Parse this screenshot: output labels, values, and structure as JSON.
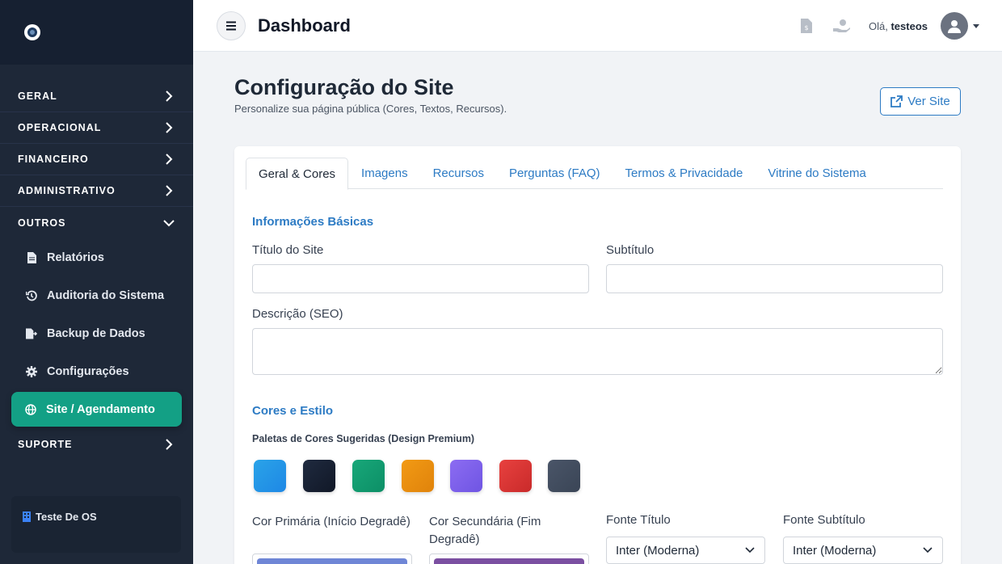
{
  "sidebar": {
    "sections": [
      {
        "label": "GERAL"
      },
      {
        "label": "OPERACIONAL"
      },
      {
        "label": "FINANCEIRO"
      },
      {
        "label": "ADMINISTRATIVO"
      },
      {
        "label": "OUTROS"
      }
    ],
    "items": [
      {
        "label": "Relatórios",
        "icon": "file-icon"
      },
      {
        "label": "Auditoria do Sistema",
        "icon": "history-icon"
      },
      {
        "label": "Backup de Dados",
        "icon": "file-export-icon"
      },
      {
        "label": "Configurações",
        "icon": "gear-icon"
      },
      {
        "label": "Site / Agendamento",
        "icon": "globe-icon"
      }
    ],
    "support": {
      "label": "SUPORTE"
    },
    "footer": {
      "label": "Teste De OS"
    }
  },
  "topbar": {
    "title": "Dashboard",
    "greeting_prefix": "Olá, ",
    "username": "testeos"
  },
  "page": {
    "title": "Configuração do Site",
    "subtitle": "Personalize sua página pública (Cores, Textos, Recursos).",
    "view_site_label": "Ver Site"
  },
  "tabs": [
    {
      "label": "Geral & Cores"
    },
    {
      "label": "Imagens"
    },
    {
      "label": "Recursos"
    },
    {
      "label": "Perguntas (FAQ)"
    },
    {
      "label": "Termos & Privacidade"
    },
    {
      "label": "Vitrine do Sistema"
    }
  ],
  "form": {
    "basic_info_title": "Informações Básicas",
    "site_title_label": "Título do Site",
    "site_title_value": "",
    "subtitle_label": "Subtítulo",
    "subtitle_value": "",
    "description_label": "Descrição (SEO)",
    "description_value": "",
    "colors_title": "Cores e Estilo",
    "palettes_label": "Paletas de Cores Sugeridas (Design Premium)",
    "palettes": [
      {
        "from": "#2aa3e8",
        "to": "#1e88e5"
      },
      {
        "from": "#1f2a3f",
        "to": "#111827"
      },
      {
        "from": "#18a779",
        "to": "#0c8f66"
      },
      {
        "from": "#f29a14",
        "to": "#e0830b"
      },
      {
        "from": "#8c6cf2",
        "to": "#6f55e3"
      },
      {
        "from": "#e8413f",
        "to": "#c92a2a"
      },
      {
        "from": "#4a5568",
        "to": "#3a4556"
      }
    ],
    "primary_color_label": "Cor Primária (Início Degradê)",
    "primary_color": "#6f86d6",
    "secondary_color_label": "Cor Secundária (Fim Degradê)",
    "secondary_color": "#7b4fa1",
    "title_font_label": "Fonte Título",
    "title_font_value": "Inter (Moderna)",
    "subtitle_font_label": "Fonte Subtítulo",
    "subtitle_font_value": "Inter (Moderna)"
  },
  "colors": {
    "accent": "#2d7bc4",
    "active_nav": "#13a085",
    "sidebar_bg": "#1e2838"
  }
}
